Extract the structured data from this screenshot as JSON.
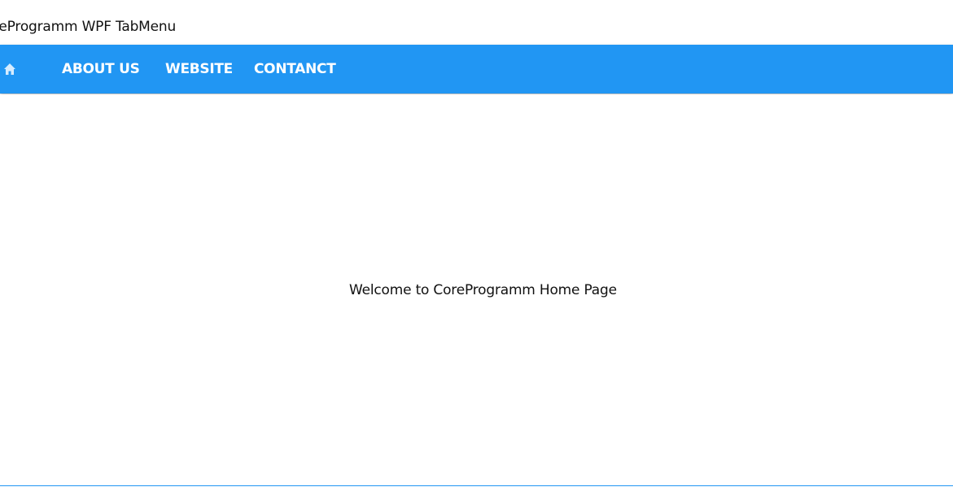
{
  "window": {
    "title": "CoreProgramm WPF TabMenu",
    "visible_title": "reProgramm WPF TabMenu"
  },
  "tabs": [
    {
      "icon": "home-icon"
    },
    {
      "label": "ABOUT US"
    },
    {
      "label": "WEBSITE"
    },
    {
      "label": "CONTANCT"
    }
  ],
  "content": {
    "message": "Welcome to CoreProgramm Home Page"
  },
  "colors": {
    "accent": "#2196F3",
    "tab_text": "#FFFFFF",
    "text": "#111111",
    "background": "#FFFFFF"
  }
}
